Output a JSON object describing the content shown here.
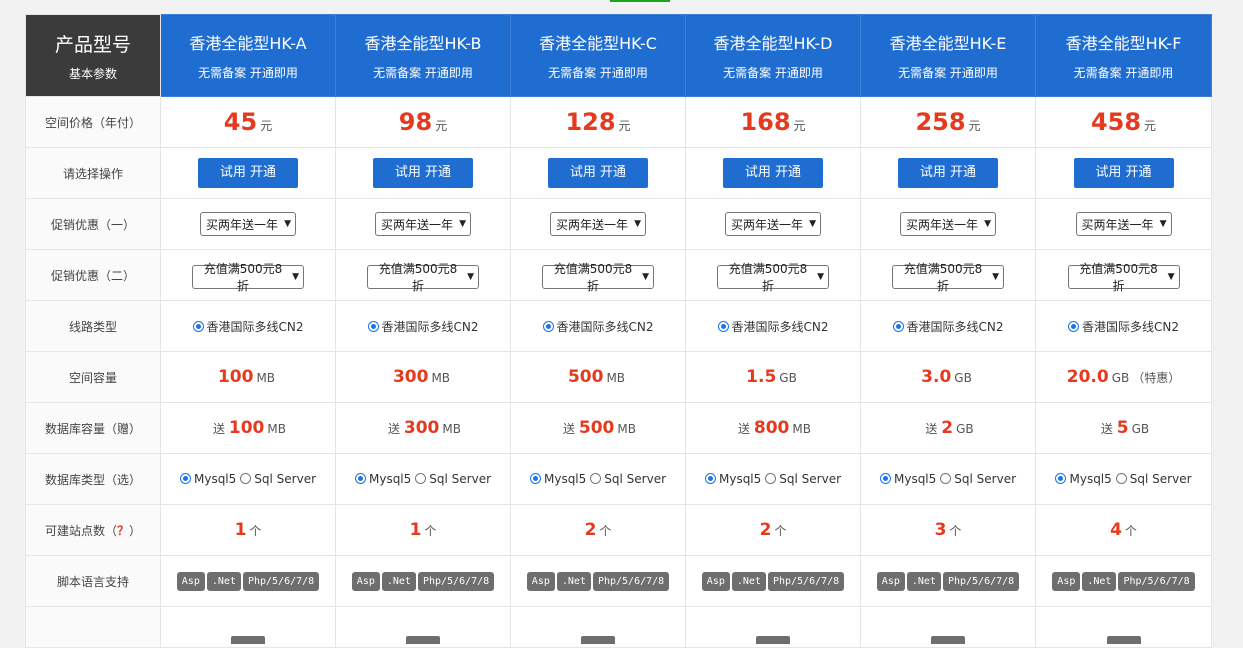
{
  "header": {
    "corner_title": "产品型号",
    "corner_sub": "基本参数",
    "products": [
      {
        "name": "香港全能型HK-A",
        "sub": "无需备案 开通即用"
      },
      {
        "name": "香港全能型HK-B",
        "sub": "无需备案 开通即用"
      },
      {
        "name": "香港全能型HK-C",
        "sub": "无需备案 开通即用"
      },
      {
        "name": "香港全能型HK-D",
        "sub": "无需备案 开通即用"
      },
      {
        "name": "香港全能型HK-E",
        "sub": "无需备案 开通即用"
      },
      {
        "name": "香港全能型HK-F",
        "sub": "无需备案 开通即用"
      }
    ]
  },
  "labels": {
    "price": "空间价格（年付）",
    "action": "请选择操作",
    "promo1": "促销优惠（一）",
    "promo2": "促销优惠（二）",
    "line": "线路类型",
    "space": "空间容量",
    "db_size": "数据库容量（赠）",
    "db_type": "数据库类型（选）",
    "sites_prefix": "可建站点数（",
    "sites_q": "？",
    "sites_suffix": "）",
    "script": "脚本语言支持"
  },
  "price_unit": "元",
  "button_label": "试用 开通",
  "promo1_value": "买两年送一年",
  "promo2_value": "充值满500元8折",
  "line_option": "香港国际多线CN2",
  "db_prefix": "送",
  "db_opt1": "Mysql5",
  "db_opt2": "Sql Server",
  "sites_unit": "个",
  "script_tags": {
    "asp": "Asp",
    "net": ".Net",
    "php": "Php/5/6/7/8"
  },
  "prices": [
    "45",
    "98",
    "128",
    "168",
    "258",
    "458"
  ],
  "space": [
    {
      "val": "100",
      "unit": "MB",
      "note": ""
    },
    {
      "val": "300",
      "unit": "MB",
      "note": ""
    },
    {
      "val": "500",
      "unit": "MB",
      "note": ""
    },
    {
      "val": "1.5",
      "unit": "GB",
      "note": ""
    },
    {
      "val": "3.0",
      "unit": "GB",
      "note": ""
    },
    {
      "val": "20.0",
      "unit": "GB",
      "note": "（特惠）"
    }
  ],
  "db_size": [
    {
      "val": "100",
      "unit": "MB"
    },
    {
      "val": "300",
      "unit": "MB"
    },
    {
      "val": "500",
      "unit": "MB"
    },
    {
      "val": "800",
      "unit": "MB"
    },
    {
      "val": "2",
      "unit": "GB"
    },
    {
      "val": "5",
      "unit": "GB"
    }
  ],
  "sites": [
    "1",
    "1",
    "2",
    "2",
    "3",
    "4"
  ],
  "colors": {
    "header_blue": "#1f6dd0",
    "header_dark": "#3b3b3b",
    "price_red": "#e63a1e",
    "tag_gray": "#6e6e6e"
  }
}
